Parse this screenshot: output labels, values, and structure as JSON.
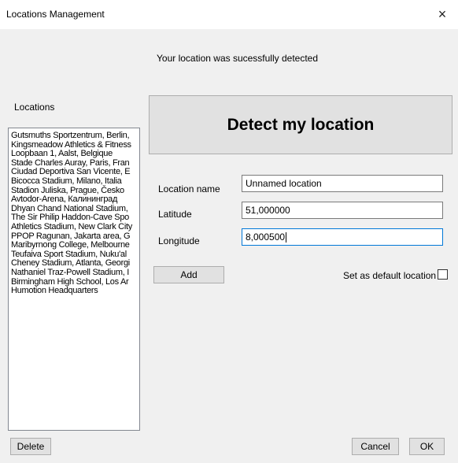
{
  "window": {
    "title": "Locations Management",
    "close_icon": "×"
  },
  "status_message": "Your location was sucessfully detected",
  "locations_label": "Locations",
  "locations": [
    "Gutsmuths Sportzentrum, Berlin,",
    "Kingsmeadow Athletics & Fitness",
    "Loopbaan 1, Aalst, Belgique",
    "Stade Charles Auray, Paris, Fran",
    "Ciudad Deportiva San Vicente, E",
    "Bicocca Stadium, Milano, Italia",
    "Stadion Juliska, Prague, Česko",
    "Avtodor-Arena, Калининград",
    "Dhyan Chand National Stadium,",
    "The Sir Philip Haddon-Cave Spo",
    "Athletics Stadium, New Clark City",
    "PPOP Ragunan, Jakarta area, G",
    "Maribyrnong College, Melbourne",
    "Teufaiva Sport Stadium, Nuku'al",
    "Cheney Stadium, Atlanta, Georgi",
    "Nathaniel Traz-Powell Stadium, I",
    "Birmingham High School, Los Ar",
    "Humotion Headquarters"
  ],
  "detect_button_label": "Detect my location",
  "form": {
    "name_label": "Location name",
    "name_value": "Unnamed location",
    "latitude_label": "Latitude",
    "latitude_value": "51,000000",
    "longitude_label": "Longitude",
    "longitude_value": "8,000500"
  },
  "add_button_label": "Add",
  "default_checkbox_label": "Set as default location",
  "default_checked": false,
  "delete_button_label": "Delete",
  "cancel_button_label": "Cancel",
  "ok_button_label": "OK"
}
